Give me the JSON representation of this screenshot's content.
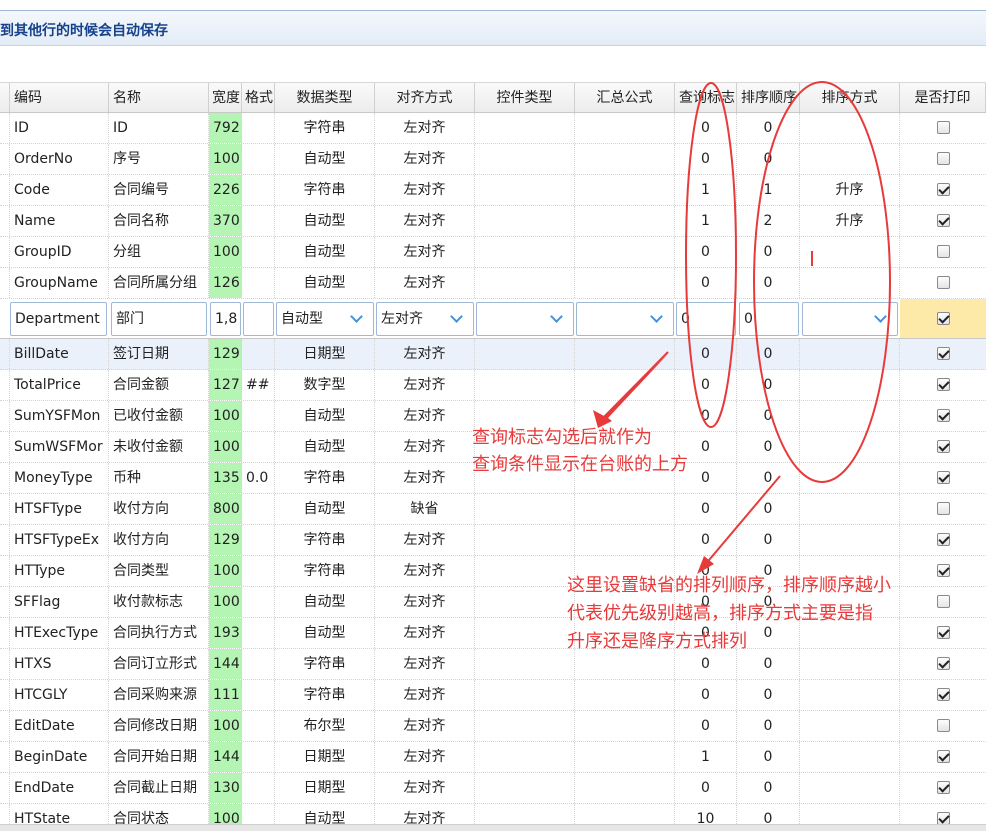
{
  "header": {
    "title": "到其他行的时候会自动保存"
  },
  "columns": [
    "编码",
    "名称",
    "宽度",
    "格式",
    "数据类型",
    "对齐方式",
    "控件类型",
    "汇总公式",
    "查询标志",
    "排序顺序",
    "排序方式",
    "是否打印"
  ],
  "rows": [
    {
      "code": "ID",
      "name": "ID",
      "width": "792",
      "format": "",
      "dtype": "字符串",
      "align": "左对齐",
      "query": "0",
      "order": "0",
      "sort": "",
      "print": false
    },
    {
      "code": "OrderNo",
      "name": "序号",
      "width": "100",
      "format": "",
      "dtype": "自动型",
      "align": "左对齐",
      "query": "0",
      "order": "0",
      "sort": "",
      "print": false
    },
    {
      "code": "Code",
      "name": "合同编号",
      "width": "226",
      "format": "",
      "dtype": "字符串",
      "align": "左对齐",
      "query": "1",
      "order": "1",
      "sort": "升序",
      "print": true
    },
    {
      "code": "Name",
      "name": "合同名称",
      "width": "370",
      "format": "",
      "dtype": "自动型",
      "align": "左对齐",
      "query": "1",
      "order": "2",
      "sort": "升序",
      "print": true
    },
    {
      "code": "GroupID",
      "name": "分组",
      "width": "100",
      "format": "",
      "dtype": "自动型",
      "align": "左对齐",
      "query": "0",
      "order": "0",
      "sort": "",
      "print": false
    },
    {
      "code": "GroupName",
      "name": "合同所属分组",
      "width": "126",
      "format": "",
      "dtype": "自动型",
      "align": "左对齐",
      "query": "0",
      "order": "0",
      "sort": "",
      "print": false
    },
    {
      "code": "BillDate",
      "name": "签订日期",
      "width": "129",
      "format": "",
      "dtype": "日期型",
      "align": "左对齐",
      "query": "0",
      "order": "0",
      "sort": "",
      "print": true
    },
    {
      "code": "TotalPrice",
      "name": "合同金额",
      "width": "127",
      "format": "##",
      "dtype": "数字型",
      "align": "左对齐",
      "query": "0",
      "order": "0",
      "sort": "",
      "print": true
    },
    {
      "code": "SumYSFMon",
      "name": "已收付金额",
      "width": "100",
      "format": "",
      "dtype": "自动型",
      "align": "左对齐",
      "query": "0",
      "order": "0",
      "sort": "",
      "print": true
    },
    {
      "code": "SumWSFMor",
      "name": "未收付金额",
      "width": "100",
      "format": "",
      "dtype": "自动型",
      "align": "左对齐",
      "query": "0",
      "order": "0",
      "sort": "",
      "print": true
    },
    {
      "code": "MoneyType",
      "name": "币种",
      "width": "135",
      "format": "0.0",
      "dtype": "字符串",
      "align": "左对齐",
      "query": "0",
      "order": "0",
      "sort": "",
      "print": true
    },
    {
      "code": "HTSFType",
      "name": "收付方向",
      "width": "800",
      "format": "",
      "dtype": "自动型",
      "align": "缺省",
      "query": "0",
      "order": "0",
      "sort": "",
      "print": false
    },
    {
      "code": "HTSFTypeEx",
      "name": "收付方向",
      "width": "129",
      "format": "",
      "dtype": "字符串",
      "align": "左对齐",
      "query": "0",
      "order": "0",
      "sort": "",
      "print": true
    },
    {
      "code": "HTType",
      "name": "合同类型",
      "width": "100",
      "format": "",
      "dtype": "字符串",
      "align": "左对齐",
      "query": "0",
      "order": "0",
      "sort": "",
      "print": true
    },
    {
      "code": "SFFlag",
      "name": "收付款标志",
      "width": "100",
      "format": "",
      "dtype": "自动型",
      "align": "左对齐",
      "query": "0",
      "order": "0",
      "sort": "",
      "print": false
    },
    {
      "code": "HTExecType",
      "name": "合同执行方式",
      "width": "193",
      "format": "",
      "dtype": "自动型",
      "align": "左对齐",
      "query": "0",
      "order": "0",
      "sort": "",
      "print": true
    },
    {
      "code": "HTXS",
      "name": "合同订立形式",
      "width": "144",
      "format": "",
      "dtype": "字符串",
      "align": "左对齐",
      "query": "0",
      "order": "0",
      "sort": "",
      "print": true
    },
    {
      "code": "HTCGLY",
      "name": "合同采购来源",
      "width": "111",
      "format": "",
      "dtype": "字符串",
      "align": "左对齐",
      "query": "0",
      "order": "0",
      "sort": "",
      "print": true
    },
    {
      "code": "EditDate",
      "name": "合同修改日期",
      "width": "100",
      "format": "",
      "dtype": "布尔型",
      "align": "左对齐",
      "query": "0",
      "order": "0",
      "sort": "",
      "print": false
    },
    {
      "code": "BeginDate",
      "name": "合同开始日期",
      "width": "144",
      "format": "",
      "dtype": "日期型",
      "align": "左对齐",
      "query": "1",
      "order": "0",
      "sort": "",
      "print": true
    },
    {
      "code": "EndDate",
      "name": "合同截止日期",
      "width": "130",
      "format": "",
      "dtype": "日期型",
      "align": "左对齐",
      "query": "0",
      "order": "0",
      "sort": "",
      "print": true
    },
    {
      "code": "HTState",
      "name": "合同状态",
      "width": "100",
      "format": "",
      "dtype": "自动型",
      "align": "左对齐",
      "query": "10",
      "order": "0",
      "sort": "",
      "print": true
    }
  ],
  "editing_row": {
    "code": "Department",
    "name": "部门",
    "width": "1,8",
    "format": "",
    "dtype": "自动型",
    "align": "左对齐",
    "control": "",
    "summary": "",
    "query": "0",
    "order": "0",
    "sort": "",
    "print": true
  },
  "annotations": {
    "query_note": [
      "查询标志勾选后就作为",
      "查询条件显示在台账的上方"
    ],
    "sort_note": [
      "这里设置缺省的排列顺序，排序顺序越小",
      "代表优先级别越高，排序方式主要是指",
      "升序还是降序方式排列"
    ]
  },
  "colors": {
    "accent_red": "#e83a3a",
    "width_col_green": "#b4f5b4",
    "header_blue": "#15428b"
  }
}
